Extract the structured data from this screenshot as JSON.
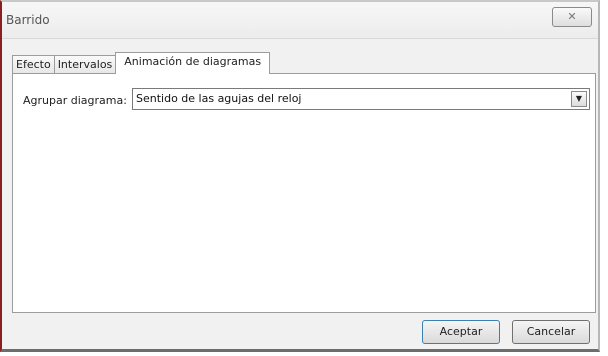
{
  "window": {
    "title": "Barrido",
    "close_glyph": "✕"
  },
  "tabs": [
    {
      "label": "Efecto",
      "active": false
    },
    {
      "label": "Intervalos",
      "active": false
    },
    {
      "label": "Animación de diagramas",
      "active": true
    }
  ],
  "form": {
    "group_label": "Agrupar diagrama:",
    "group_value": "Sentido de las agujas del reloj"
  },
  "buttons": {
    "ok_label": "Aceptar",
    "cancel_label": "Cancelar"
  }
}
